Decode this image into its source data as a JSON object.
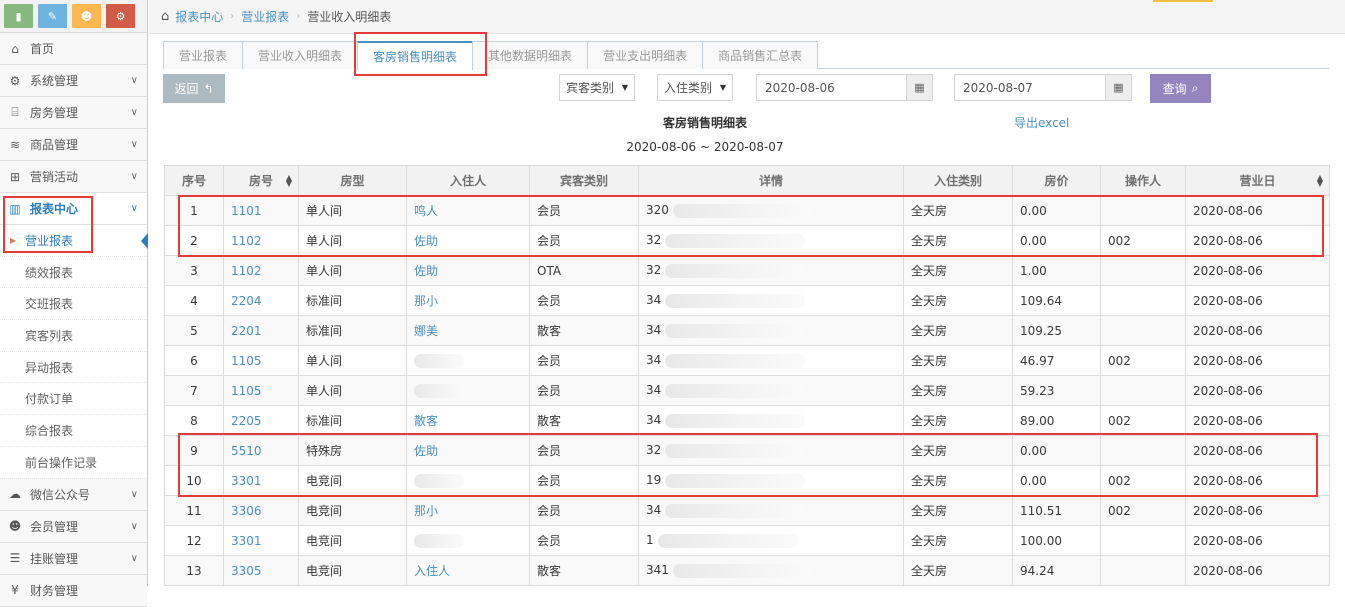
{
  "sidebar": {
    "shortcuts": [
      {
        "icon": "signal-icon",
        "color": "#87b87f"
      },
      {
        "icon": "pencil-icon",
        "color": "#6fb3e0"
      },
      {
        "icon": "users-icon",
        "color": "#ffb752"
      },
      {
        "icon": "cogs-icon",
        "color": "#d15b47"
      }
    ],
    "items": [
      {
        "label": "首页",
        "icon": "home-icon",
        "has_children": false
      },
      {
        "label": "系统管理",
        "icon": "gear-icon",
        "has_children": true
      },
      {
        "label": "房务管理",
        "icon": "bank-icon",
        "has_children": true
      },
      {
        "label": "商品管理",
        "icon": "database-icon",
        "has_children": true
      },
      {
        "label": "营销活动",
        "icon": "gift-icon",
        "has_children": true
      },
      {
        "label": "报表中心",
        "icon": "bar-chart-icon",
        "has_children": true,
        "active": true
      }
    ],
    "sub_items": [
      "营业报表",
      "绩效报表",
      "交班报表",
      "宾客列表",
      "异动报表",
      "付款订单",
      "综合报表",
      "前台操作记录"
    ],
    "active_sub": "营业报表",
    "items_after": [
      {
        "label": "微信公众号",
        "icon": "cloud-icon"
      },
      {
        "label": "会员管理",
        "icon": "users-icon"
      },
      {
        "label": "挂账管理",
        "icon": "list-icon"
      },
      {
        "label": "财务管理",
        "icon": "money-icon"
      }
    ]
  },
  "breadcrumb": {
    "items": [
      "报表中心",
      "营业报表"
    ],
    "current": "营业收入明细表"
  },
  "tabs": [
    "营业报表",
    "营业收入明细表",
    "客房销售明细表",
    "其他数据明细表",
    "营业支出明细表",
    "商品销售汇总表"
  ],
  "active_tab": "客房销售明细表",
  "toolbar": {
    "back_label": "返回",
    "guest_type_select": "宾客类别",
    "checkin_type_select": "入住类别",
    "start_date": "2020-08-06",
    "end_date": "2020-08-07",
    "query_label": "查询"
  },
  "report": {
    "title": "客房销售明细表",
    "export_label": "导出excel",
    "date_range": "2020-08-06 ~ 2020-08-07"
  },
  "table": {
    "headers": [
      "序号",
      "房号",
      "房型",
      "入住人",
      "宾客类别",
      "详情",
      "入住类别",
      "房价",
      "操作人",
      "营业日"
    ],
    "rows": [
      {
        "no": "1",
        "room": "1101",
        "type": "单人间",
        "guest": "鸣人",
        "category": "会员",
        "detail": "320",
        "checkin": "全天房",
        "price": "0.00",
        "operator": "",
        "date": "2020-08-06"
      },
      {
        "no": "2",
        "room": "1102",
        "type": "单人间",
        "guest": "佐助",
        "category": "会员",
        "detail": "32",
        "checkin": "全天房",
        "price": "0.00",
        "operator": "002",
        "date": "2020-08-06"
      },
      {
        "no": "3",
        "room": "1102",
        "type": "单人间",
        "guest": "佐助",
        "category": "OTA",
        "detail": "32",
        "checkin": "全天房",
        "price": "1.00",
        "operator": "",
        "date": "2020-08-06"
      },
      {
        "no": "4",
        "room": "2204",
        "type": "标准间",
        "guest": "那小",
        "category": "会员",
        "detail": "34",
        "checkin": "全天房",
        "price": "109.64",
        "operator": "",
        "date": "2020-08-06"
      },
      {
        "no": "5",
        "room": "2201",
        "type": "标准间",
        "guest": "娜美",
        "category": "散客",
        "detail": "34",
        "checkin": "全天房",
        "price": "109.25",
        "operator": "",
        "date": "2020-08-06"
      },
      {
        "no": "6",
        "room": "1105",
        "type": "单人间",
        "guest": "",
        "category": "会员",
        "detail": "34",
        "checkin": "全天房",
        "price": "46.97",
        "operator": "002",
        "date": "2020-08-06"
      },
      {
        "no": "7",
        "room": "1105",
        "type": "单人间",
        "guest": "",
        "category": "会员",
        "detail": "34",
        "checkin": "全天房",
        "price": "59.23",
        "operator": "",
        "date": "2020-08-06"
      },
      {
        "no": "8",
        "room": "2205",
        "type": "标准间",
        "guest": "散客",
        "category": "散客",
        "detail": "34",
        "checkin": "全天房",
        "price": "89.00",
        "operator": "002",
        "date": "2020-08-06"
      },
      {
        "no": "9",
        "room": "5510",
        "type": "特殊房",
        "guest": "佐助",
        "category": "会员",
        "detail": "32",
        "checkin": "全天房",
        "price": "0.00",
        "operator": "",
        "date": "2020-08-06"
      },
      {
        "no": "10",
        "room": "3301",
        "type": "电竞间",
        "guest": "",
        "category": "会员",
        "detail": "19",
        "checkin": "全天房",
        "price": "0.00",
        "operator": "002",
        "date": "2020-08-06"
      },
      {
        "no": "11",
        "room": "3306",
        "type": "电竞间",
        "guest": "那小",
        "category": "会员",
        "detail": "34",
        "checkin": "全天房",
        "price": "110.51",
        "operator": "002",
        "date": "2020-08-06"
      },
      {
        "no": "12",
        "room": "3301",
        "type": "电竞间",
        "guest": "",
        "category": "会员",
        "detail": "1",
        "checkin": "全天房",
        "price": "100.00",
        "operator": "",
        "date": "2020-08-06"
      },
      {
        "no": "13",
        "room": "3305",
        "type": "电竞间",
        "guest": "入住人",
        "category": "散客",
        "detail": "341",
        "checkin": "全天房",
        "price": "94.24",
        "operator": "",
        "date": "2020-08-06"
      }
    ]
  },
  "colors": {
    "accent": "#4c8fbd",
    "highlight": "#e23b3b",
    "query_button": "#9585bf",
    "back_button": "#abbac3"
  }
}
